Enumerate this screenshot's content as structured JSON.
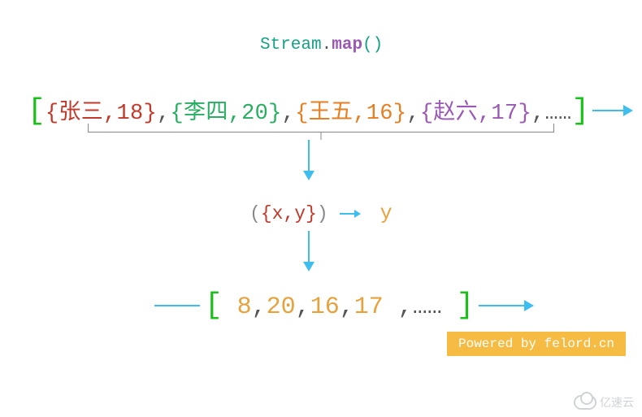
{
  "title": {
    "stream": "Stream",
    "dot": ".",
    "map": "map",
    "paren": "()"
  },
  "input_list": {
    "open": "[",
    "items": [
      {
        "text": "{张三,18}",
        "class": "obj1"
      },
      {
        "text": "{李四,20}",
        "class": "obj2"
      },
      {
        "text": "{王五,16}",
        "class": "obj3"
      },
      {
        "text": "{赵六,17}",
        "class": "obj4"
      }
    ],
    "sep": ",",
    "ellipsis": "……",
    "close": "]"
  },
  "lambda": {
    "open": "(",
    "arg": "{x,y}",
    "close": ")",
    "out": "y"
  },
  "output_list": {
    "open": "[",
    "values": [
      "8",
      "20",
      "16",
      "17"
    ],
    "sep": ",",
    "ellipsis": "……",
    "close": "]"
  },
  "credit": "Powered by felord.cn",
  "watermark": "亿速云",
  "colors": {
    "arrow": "#3dbeef",
    "bracket_green": "#17c117",
    "credit_bg": "#f6bb42",
    "stream": "#16a085",
    "map": "#9b59b6"
  }
}
